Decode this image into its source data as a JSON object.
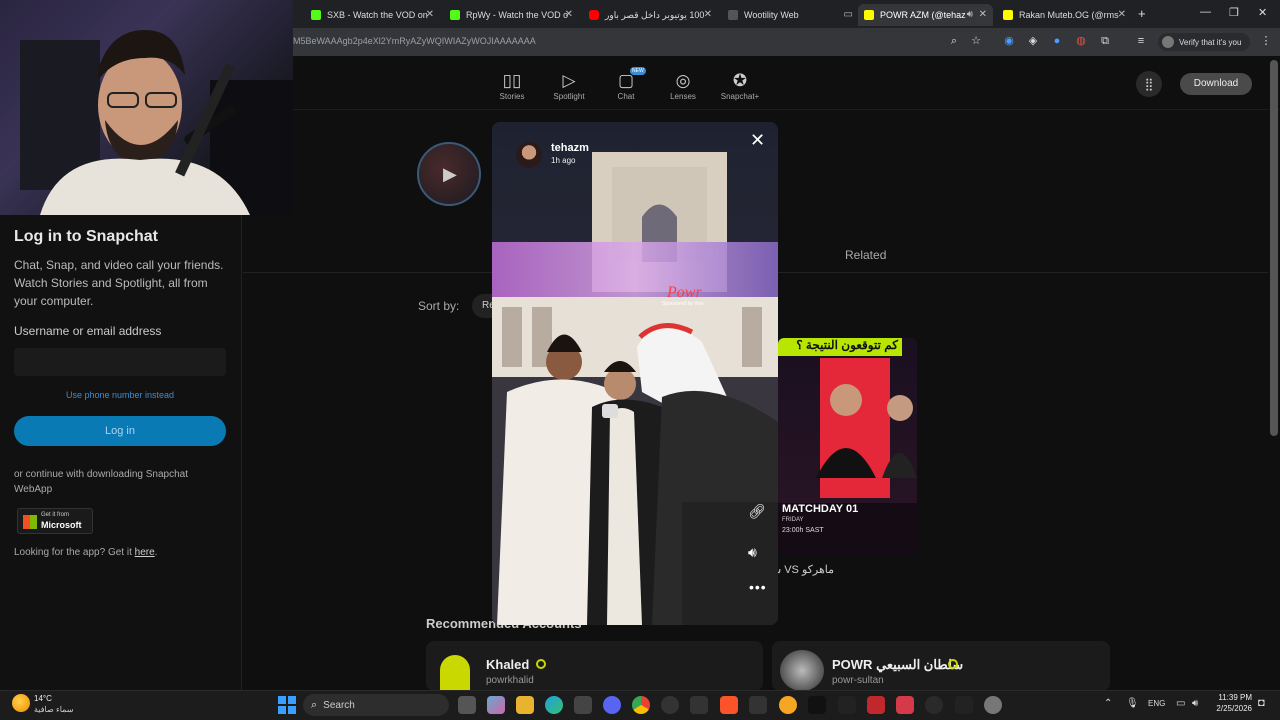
{
  "tabs": [
    {
      "title": "SXB - Watch the VOD on",
      "color": "#53fc18",
      "active": false
    },
    {
      "title": "RpWy - Watch the VOD o",
      "color": "#53fc18",
      "active": false
    },
    {
      "title": "100 يوتيوبر داخل قصر باور",
      "color": "#ff0000",
      "active": false
    },
    {
      "title": "Wootility Web",
      "color": "#444444",
      "active": false
    },
    {
      "title": "POWR AZM (@tehaz",
      "color": "#fffc00",
      "active": true
    },
    {
      "title": "Rakan Muteb.OG (@rms",
      "color": "#fffc00",
      "active": false
    }
  ],
  "address_bar": {
    "url": "M5BeWAAAgb2p4eXl2YmRyAZyWQIWIAZyWOJIAAAAAAA",
    "verify_text": "Verify that it's you"
  },
  "snap_nav": {
    "items": [
      {
        "label": "Stories",
        "icon": "stories-icon",
        "glyph": "▯▯"
      },
      {
        "label": "Spotlight",
        "icon": "spotlight-icon",
        "glyph": "▷"
      },
      {
        "label": "Chat",
        "icon": "chat-icon",
        "glyph": "▢",
        "badge": "NEW"
      },
      {
        "label": "Lenses",
        "icon": "lenses-icon",
        "glyph": "◎"
      },
      {
        "label": "Snapchat+",
        "icon": "snapchat-plus-icon",
        "glyph": "✪"
      }
    ],
    "download_label": "Download"
  },
  "sidebar": {
    "title": "Log in to Snapchat",
    "description": "Chat, Snap, and video call your friends. Watch Stories and Spotlight, all from your computer.",
    "username_label": "Username or email address",
    "phone_link": "Use phone number instead",
    "login_label": "Log in",
    "continue_text": "or continue with downloading Snapchat WebApp",
    "ms_badge_top": "Get it from",
    "ms_badge_bottom": "Microsoft",
    "app_text": "Looking for the app? Get it ",
    "app_link": "here",
    "app_suffix": "."
  },
  "main": {
    "related_tab": "Related",
    "sort_label": "Sort by:",
    "sort_value": "Re",
    "card_arabic_title": "كم تتوقعون النتيجة ؟",
    "card_caption": "ماهركو VS شا",
    "card_badge": "MATCHDAY 01",
    "card_sub": "FRIDAY",
    "card_time": "23:00h SAST",
    "recommended_title": "Recommended Accounts",
    "accounts": [
      {
        "name": "Khaled",
        "handle": "powrkhalid"
      },
      {
        "name": "POWR سلطان السبيعي",
        "handle": "powr-sultan"
      }
    ]
  },
  "story": {
    "username": "tehazm",
    "time_ago": "1h ago",
    "sign_text": "Powr",
    "sign_sub": "Sponsored by Yelo"
  },
  "taskbar": {
    "weather_temp": "14°C",
    "weather_desc": "سماء صافية",
    "search_label": "Search",
    "lang": "ENG",
    "time": "11:39 PM",
    "date": "2/25/2026"
  },
  "colors": {
    "snap_yellow": "#fffc00",
    "login_blue": "#0a7ab5",
    "link_blue": "#3b8ed4"
  }
}
